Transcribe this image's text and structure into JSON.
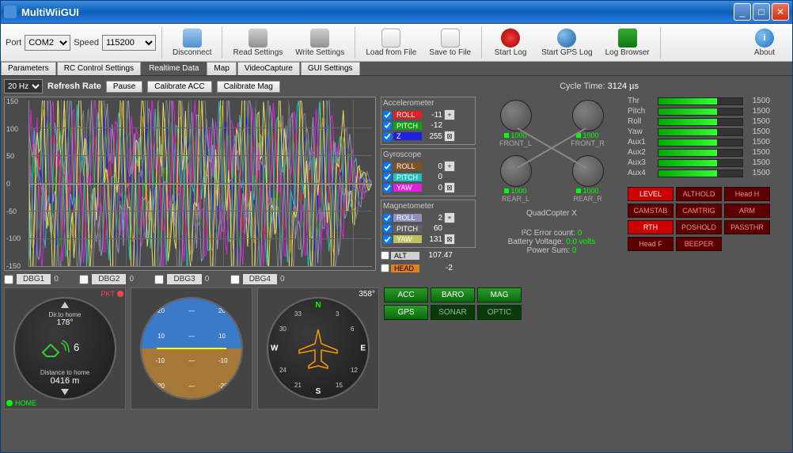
{
  "window": {
    "title": "MultiWiiGUI"
  },
  "toolbar": {
    "port_label": "Port",
    "port_value": "COM2",
    "speed_label": "Speed",
    "speed_value": "115200",
    "buttons": {
      "disconnect": "Disconnect",
      "read": "Read Settings",
      "write": "Write Settings",
      "load": "Load from File",
      "save": "Save to File",
      "startlog": "Start Log",
      "gpslog": "Start GPS Log",
      "logbrowser": "Log Browser",
      "about": "About"
    }
  },
  "tabs": [
    "Parameters",
    "RC Control Settings",
    "Realtime Data",
    "Map",
    "VideoCapture",
    "GUI Settings"
  ],
  "active_tab": 2,
  "controls": {
    "refresh_value": "20 Hz",
    "refresh_label": "Refresh Rate",
    "pause": "Pause",
    "cal_acc": "Calibrate ACC",
    "cal_mag": "Calibrate Mag"
  },
  "cycle_time_label": "Cycle Time:",
  "cycle_time_value": "3124 µs",
  "sensors": {
    "acc": {
      "title": "Accelerometer",
      "rows": [
        {
          "name": "ROLL",
          "val": "-11",
          "color": "#e02020"
        },
        {
          "name": "PITCH",
          "val": "-12",
          "color": "#10a010"
        },
        {
          "name": "Z",
          "val": "255",
          "color": "#2020e0"
        }
      ]
    },
    "gyro": {
      "title": "Gyroscope",
      "rows": [
        {
          "name": "ROLL",
          "val": "0",
          "color": "#805020"
        },
        {
          "name": "PITCH",
          "val": "0",
          "color": "#20c0c0"
        },
        {
          "name": "YAW",
          "val": "0",
          "color": "#e020e0"
        }
      ]
    },
    "mag": {
      "title": "Magnetometer",
      "rows": [
        {
          "name": "ROLL",
          "val": "2",
          "color": "#9090c0"
        },
        {
          "name": "PITCH",
          "val": "60",
          "color": "#606060"
        },
        {
          "name": "YAW",
          "val": "131",
          "color": "#c0c060"
        }
      ]
    },
    "extra": [
      {
        "name": "ALT",
        "val": "107.47",
        "color": "#d0d0d0"
      },
      {
        "name": "HEAD",
        "val": "-2",
        "color": "#e08020"
      }
    ]
  },
  "dbg": [
    {
      "name": "DBG1",
      "val": "0"
    },
    {
      "name": "DBG2",
      "val": "0"
    },
    {
      "name": "DBG3",
      "val": "0"
    },
    {
      "name": "DBG4",
      "val": "0"
    }
  ],
  "motors": {
    "type": "QuadCopter X",
    "list": [
      {
        "name": "FRONT_L",
        "val": "1000"
      },
      {
        "name": "FRONT_R",
        "val": "1000"
      },
      {
        "name": "REAR_L",
        "val": "1000"
      },
      {
        "name": "REAR_R",
        "val": "1000"
      }
    ]
  },
  "status": {
    "i2c_label": "I²C Error count:",
    "i2c_val": "0",
    "batt_label": "Battery Voltage:",
    "batt_val": "0.0 volts",
    "psum_label": "Power Sum:",
    "psum_val": "0"
  },
  "channels": [
    {
      "name": "Thr",
      "val": "1500"
    },
    {
      "name": "Pitch",
      "val": "1500"
    },
    {
      "name": "Roll",
      "val": "1500"
    },
    {
      "name": "Yaw",
      "val": "1500"
    },
    {
      "name": "Aux1",
      "val": "1500"
    },
    {
      "name": "Aux2",
      "val": "1500"
    },
    {
      "name": "Aux3",
      "val": "1500"
    },
    {
      "name": "Aux4",
      "val": "1500"
    }
  ],
  "modes": [
    {
      "name": "LEVEL",
      "on": true
    },
    {
      "name": "ALTHOLD",
      "on": false
    },
    {
      "name": "Head H",
      "on": false
    },
    {
      "name": "CAMSTAB",
      "on": false
    },
    {
      "name": "CAMTRIG",
      "on": false
    },
    {
      "name": "ARM",
      "on": false
    },
    {
      "name": "RTH",
      "on": true
    },
    {
      "name": "POSHOLD",
      "on": false
    },
    {
      "name": "PASSTHR",
      "on": false
    },
    {
      "name": "Head F",
      "on": false
    },
    {
      "name": "BEEPER",
      "on": false
    }
  ],
  "gps": {
    "dir_label": "Dir.to home",
    "dir_val": "178°",
    "sats": "6",
    "dist_label": "Distance to home",
    "dist_val": "0416 m",
    "home": "HOME",
    "pkt": "PKT"
  },
  "compass": {
    "heading": "358°",
    "n": "N",
    "s": "S",
    "e": "E",
    "w": "W"
  },
  "horizon_ticks": [
    "20",
    "10",
    "-10",
    "-20"
  ],
  "sensor_btns": [
    {
      "name": "ACC",
      "on": true
    },
    {
      "name": "BARO",
      "on": true
    },
    {
      "name": "MAG",
      "on": true
    },
    {
      "name": "GPS",
      "on": true
    },
    {
      "name": "SONAR",
      "on": false
    },
    {
      "name": "OPTIC",
      "on": false
    }
  ],
  "chart_data": {
    "type": "line",
    "title": "",
    "xlabel": "",
    "ylabel": "",
    "ylim": [
      -150,
      150
    ],
    "yticks": [
      -150,
      -100,
      -50,
      0,
      50,
      100,
      150
    ],
    "x_range": [
      0,
      430
    ],
    "series": [
      {
        "name": "ACC_ROLL",
        "color": "#e02020"
      },
      {
        "name": "ACC_PITCH",
        "color": "#10a010"
      },
      {
        "name": "ACC_Z",
        "color": "#2020e0"
      },
      {
        "name": "GYRO_ROLL",
        "color": "#c09020"
      },
      {
        "name": "GYRO_PITCH",
        "color": "#20c0c0"
      },
      {
        "name": "GYRO_YAW",
        "color": "#e020e0"
      },
      {
        "name": "MAG_ROLL",
        "color": "#9090c0"
      },
      {
        "name": "MAG_PITCH",
        "color": "#808080"
      },
      {
        "name": "MAG_YAW",
        "color": "#e0e060"
      }
    ],
    "note": "High-frequency oscillating noise across ~0-380px decaying after, values roughly within ±120"
  }
}
